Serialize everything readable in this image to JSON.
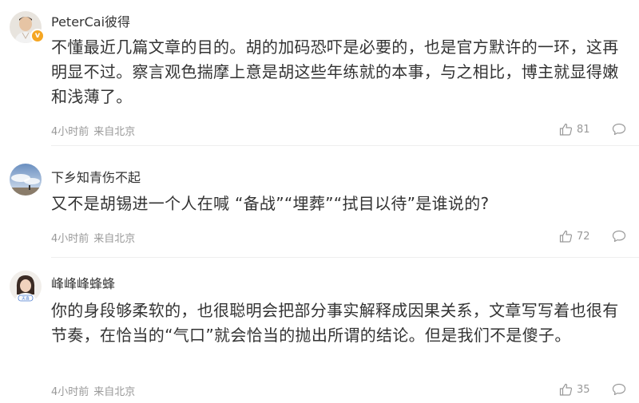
{
  "comments": [
    {
      "username": "PeterCai彼得",
      "verified": true,
      "verified_symbol": "v",
      "content": "不懂最近几篇文章的目的。胡的加码恐吓是必要的，也是官方默许的一环，这再明显不过。察言观色揣摩上意是胡这些年练就的本事，与之相比，博主就显得嫩和浅薄了。",
      "time": "4小时前",
      "source": "来自北京",
      "likes": "81",
      "avatar_icon": "male-portrait-avatar"
    },
    {
      "username": "下乡知青伤不起",
      "verified": false,
      "content": "又不是胡锡进一个人在喊 “备战”“埋葬”“拭目以待”是谁说的?",
      "time": "4小时前",
      "source": "来自北京",
      "likes": "72",
      "avatar_icon": "sky-landscape-avatar"
    },
    {
      "username": "峰峰峰蜂蜂",
      "verified": false,
      "content": "你的身段够柔软的，也很聪明会把部分事实解释成因果关系，文章写写着也很有节奏，在恰当的“气口”就会恰当的抛出所谓的结论。但是我们不是傻子。",
      "time": "4小时前",
      "source": "来自北京",
      "likes": "35",
      "avatar_icon": "female-portrait-avatar",
      "avatar_badge": "天喜"
    }
  ],
  "colors": {
    "text": "#333333",
    "meta": "#999999",
    "verified_badge": "#f5a623",
    "divider": "#eeeeee"
  }
}
